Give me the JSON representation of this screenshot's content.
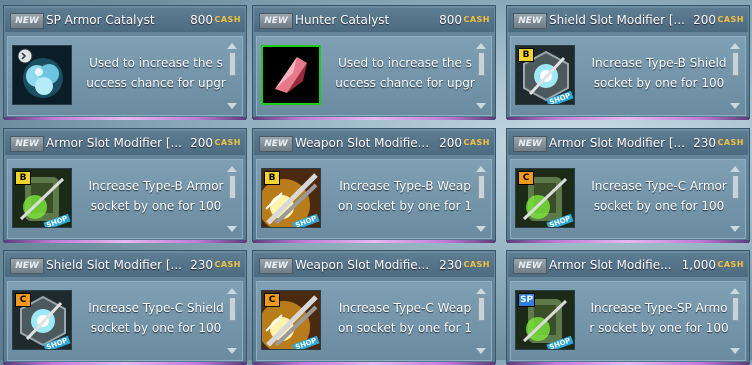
{
  "cash_label": "CASH",
  "new_label": "NEW",
  "shop_label": "SHOP",
  "items": [
    {
      "name": "SP Armor Catalyst",
      "price": "800",
      "desc1": "Used to increase the s",
      "desc2": "uccess chance for upgr",
      "icon": "sp-armor-catalyst-icon",
      "badge": ""
    },
    {
      "name": "Hunter Catalyst",
      "price": "800",
      "desc1": "Used to increase the s",
      "desc2": "uccess chance for upgr",
      "icon": "hunter-catalyst-icon",
      "badge": ""
    },
    {
      "name": "Shield Slot Modifier [...",
      "price": "200",
      "desc1": "Increase Type-B Shield",
      "desc2": "socket by one for 100",
      "icon": "shield-slot-modifier-icon",
      "badge": "B"
    },
    {
      "name": "Armor Slot Modifier [...",
      "price": "200",
      "desc1": "Increase Type-B Armor",
      "desc2": "socket by one for 100",
      "icon": "armor-slot-modifier-icon",
      "badge": "B"
    },
    {
      "name": "Weapon Slot Modifie...",
      "price": "200",
      "desc1": "Increase Type-B Weap",
      "desc2": "on socket by one for 1",
      "icon": "weapon-slot-modifier-icon",
      "badge": "B"
    },
    {
      "name": "Armor Slot Modifier [...",
      "price": "230",
      "desc1": "Increase Type-C Armor",
      "desc2": "socket by one for 100",
      "icon": "armor-slot-modifier-icon",
      "badge": "C"
    },
    {
      "name": "Shield Slot Modifier [...",
      "price": "230",
      "desc1": "Increase Type-C Shield",
      "desc2": "socket by one for 100",
      "icon": "shield-slot-modifier-icon",
      "badge": "C"
    },
    {
      "name": "Weapon Slot Modifie...",
      "price": "230",
      "desc1": "Increase Type-C Weap",
      "desc2": "on socket by one for 1",
      "icon": "weapon-slot-modifier-icon",
      "badge": "C"
    },
    {
      "name": "Armor Slot Modifie...",
      "price": "1,000",
      "desc1": "Increase Type-SP Armo",
      "desc2": "r socket by one for 100",
      "icon": "armor-slot-modifier-icon",
      "badge": "SP"
    }
  ]
}
